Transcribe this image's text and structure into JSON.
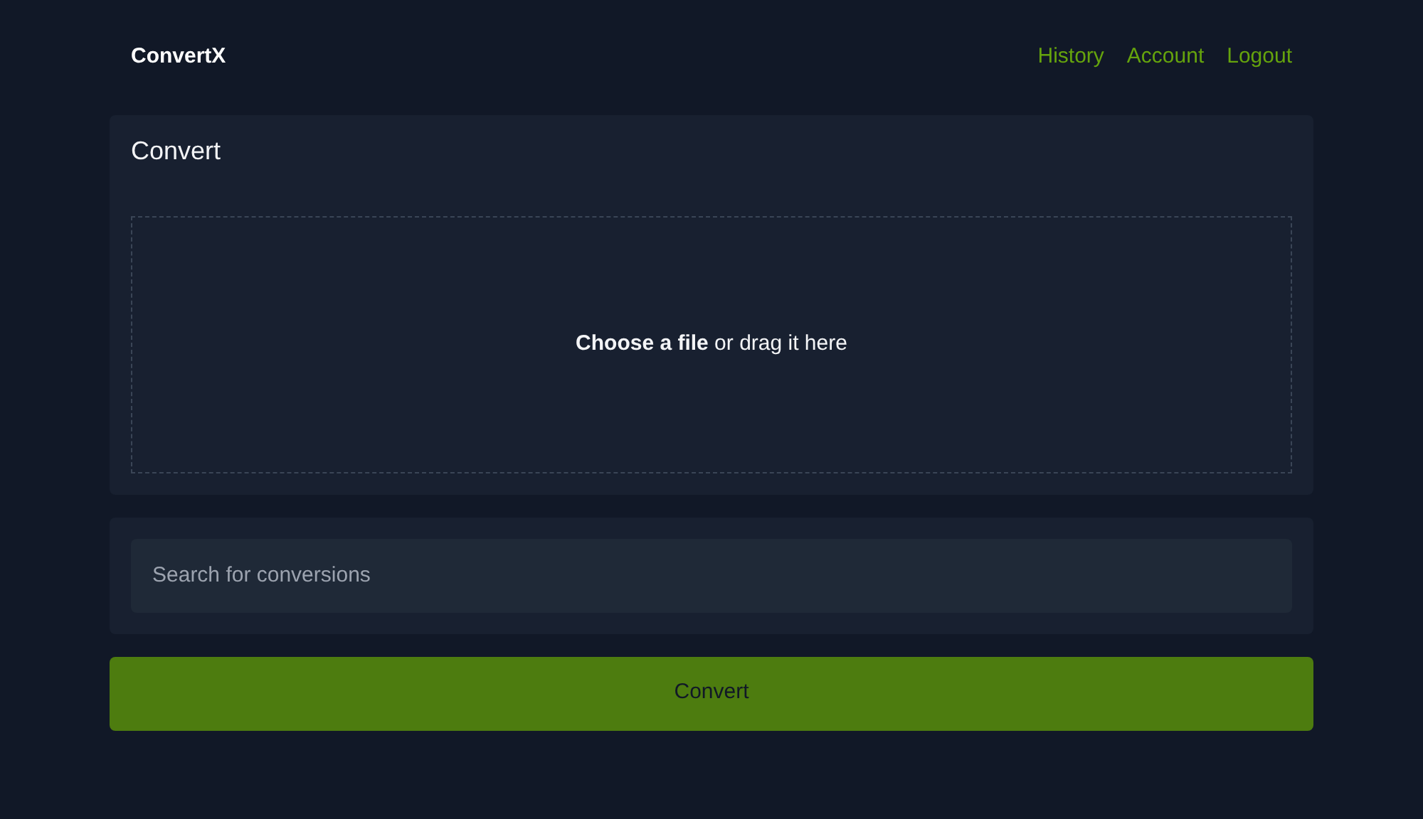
{
  "header": {
    "brand": "ConvertX",
    "nav": [
      {
        "label": "History"
      },
      {
        "label": "Account"
      },
      {
        "label": "Logout"
      }
    ]
  },
  "convert_card": {
    "title": "Convert",
    "dropzone_text": "**Choose a file** or drag it here"
  },
  "search": {
    "placeholder": "Search for conversions"
  },
  "convert_button": "Convert"
}
